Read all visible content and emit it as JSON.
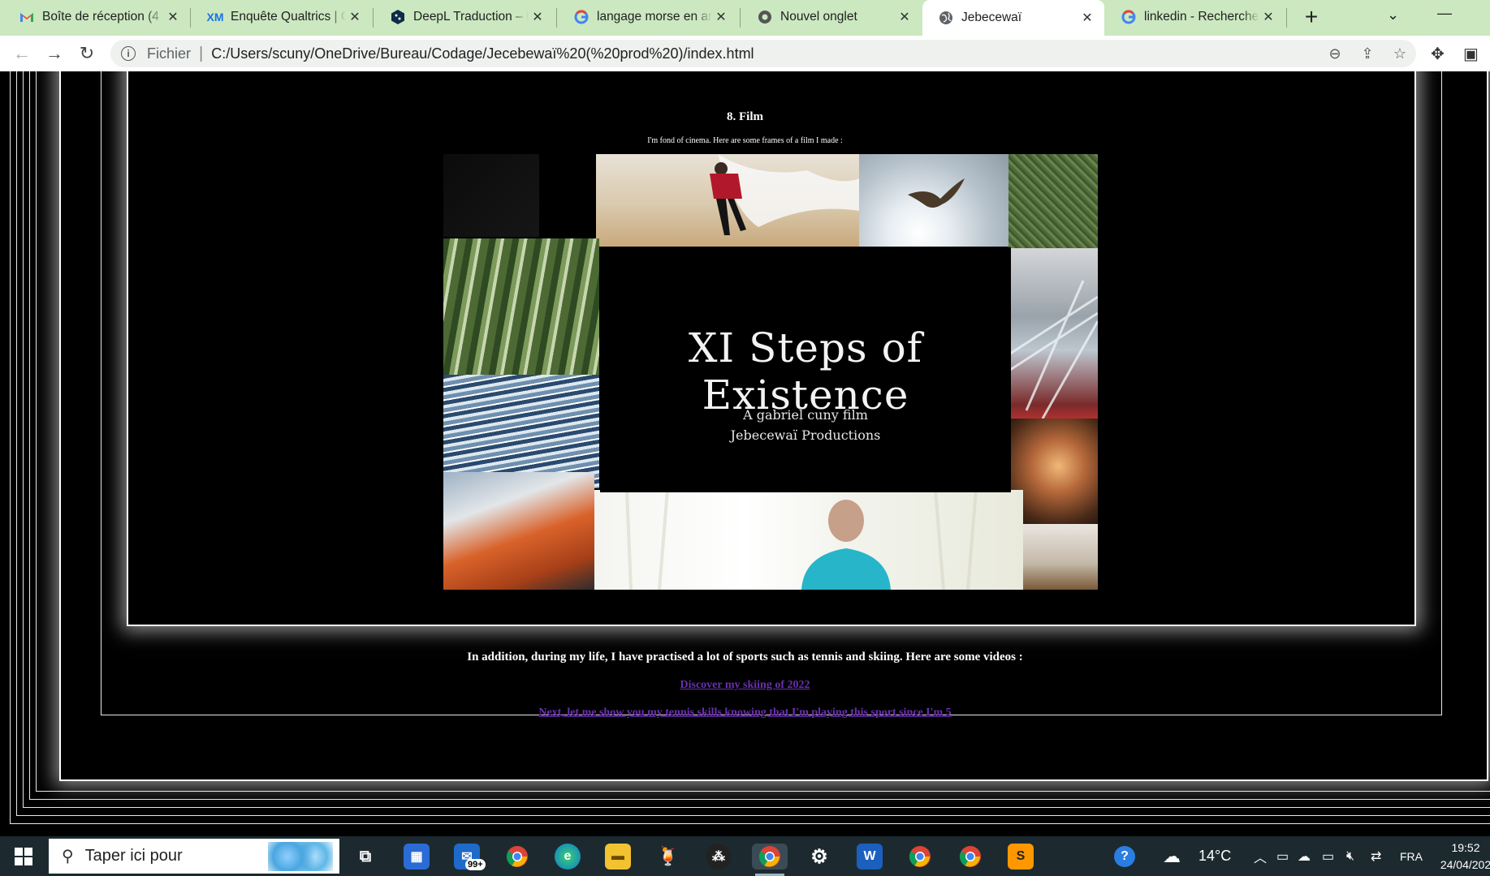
{
  "browser": {
    "tabs": [
      {
        "label": "Boîte de réception (4",
        "icon": "gmail-icon"
      },
      {
        "label": "Enquête Qualtrics | Ge",
        "icon": "qualtrics-icon"
      },
      {
        "label": "DeepL Traduction – De",
        "icon": "deepl-icon"
      },
      {
        "label": "langage morse en ang",
        "icon": "google-icon"
      },
      {
        "label": "Nouvel onglet",
        "icon": "chrome-icon"
      },
      {
        "label": "Jebecewaï",
        "icon": "globe-icon"
      },
      {
        "label": "linkedin - Recherche G",
        "icon": "google-icon"
      }
    ],
    "active_tab_index": 5,
    "address": {
      "scheme": "Fichier",
      "url": "C:/Users/scuny/OneDrive/Bureau/Codage/Jecebewaï%20(%20prod%20)/index.html"
    }
  },
  "page": {
    "section_title": "8.  Film",
    "section_subtitle": "I'm fond of cinema. Here are some frames of a film I made :",
    "film": {
      "title": "XI Steps of Existence",
      "credit_line1": "A gabriel cuny film",
      "credit_line2": "Jebecewaï Productions"
    },
    "sports_text": "In addition, during my life, I have practised a lot of sports such as tennis and skiing. Here are some videos :",
    "link_skiing": "Discover my skiing of 2022",
    "link_tennis": "Next, let me show you my tennis skills knowing that I'm playing this sport since I'm 5",
    "link_color": "#6a2fb0"
  },
  "taskbar": {
    "search_placeholder": "Taper ici pour",
    "mail_badge": "99+",
    "weather": "14°C",
    "language": "FRA",
    "time": "19:52",
    "date": "24/04/202"
  }
}
